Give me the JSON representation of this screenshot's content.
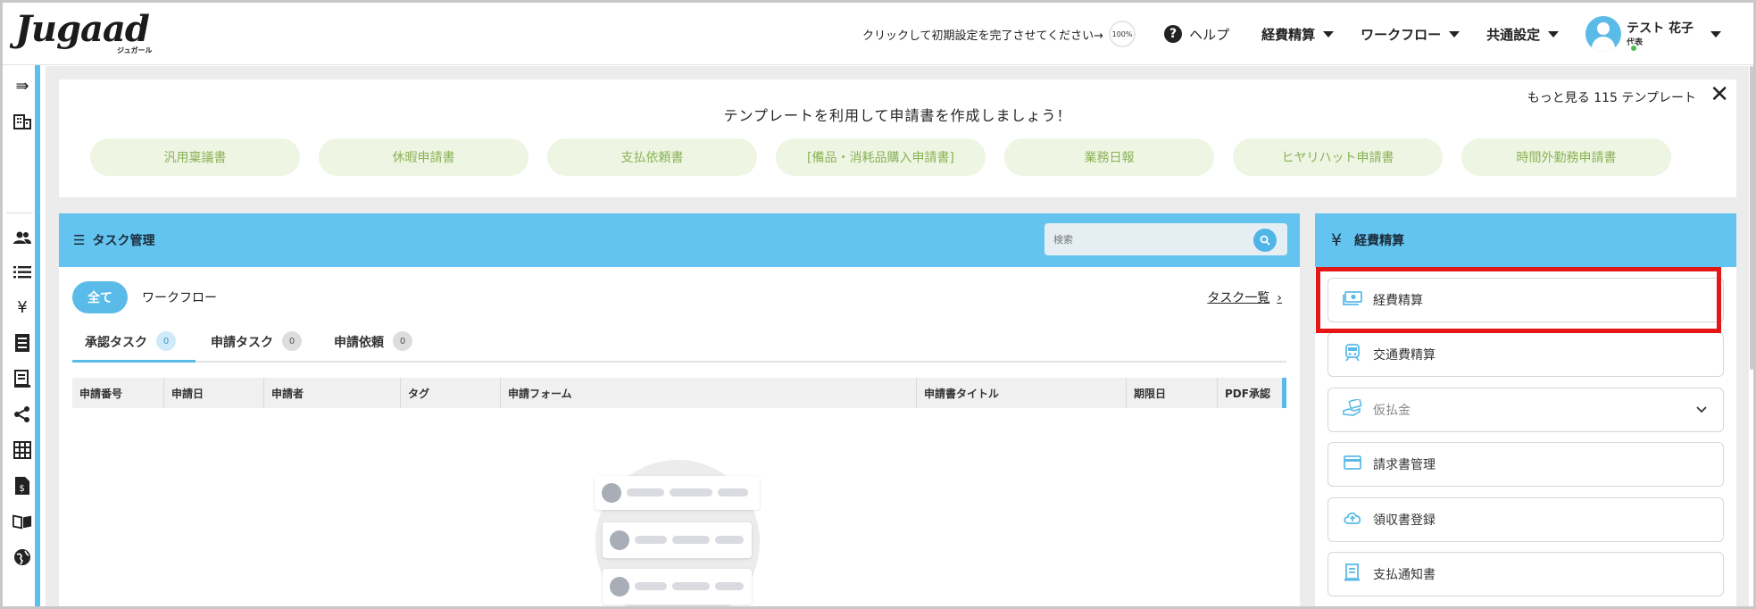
{
  "header": {
    "logo_text": "Jugaad",
    "logo_sub": "ジュガール",
    "setup_text": "クリックして初期設定を完了させてください→",
    "setup_progress": "100%",
    "help_label": "ヘルプ",
    "menus": [
      "経費精算",
      "ワークフロー",
      "共通設定"
    ],
    "user_name": "テスト 花子",
    "user_role": "代表"
  },
  "sidebar": {
    "icons": [
      "collapse-icon",
      "building-icon",
      "users-icon",
      "list-icon",
      "yen-icon",
      "document-icon",
      "receipt-icon",
      "share-icon",
      "grid-icon",
      "file-dollar-icon",
      "book-icon",
      "globe-icon"
    ]
  },
  "templates": {
    "title": "テンプレートを利用して申請書を作成しましょう！",
    "more_text": "もっと見る 115 テンプレート",
    "close_glyph": "✕",
    "items": [
      "汎用稟議書",
      "休暇申請書",
      "支払依頼書",
      "[備品・消耗品購入申請書]",
      "業務日報",
      "ヒヤリハット申請書",
      "時間外勤務申請書"
    ]
  },
  "tasks": {
    "title": "タスク管理",
    "search_placeholder": "検索",
    "filters": [
      "全て",
      "ワークフロー"
    ],
    "link_text": "タスク一覧",
    "subtabs": [
      {
        "label": "承認タスク",
        "count": "0"
      },
      {
        "label": "申請タスク",
        "count": "0"
      },
      {
        "label": "申請依頼",
        "count": "0"
      }
    ],
    "columns": [
      "申請番号",
      "申請日",
      "申請者",
      "タグ",
      "申請フォーム",
      "申請書タイトル",
      "期限日",
      "PDF承認"
    ]
  },
  "expense": {
    "title": "経費精算",
    "items": [
      {
        "label": "経費精算",
        "icon": "money-icon"
      },
      {
        "label": "交通費精算",
        "icon": "train-icon"
      },
      {
        "label": "仮払金",
        "icon": "hand-money-icon"
      },
      {
        "label": "請求書管理",
        "icon": "card-icon"
      },
      {
        "label": "領収書登録",
        "icon": "cloud-upload-icon"
      },
      {
        "label": "支払通知書",
        "icon": "notice-icon"
      }
    ]
  },
  "colors": {
    "accent": "#63c4ef",
    "template_bg": "#eef5e2",
    "template_text": "#8ab357",
    "highlight": "#e51616"
  }
}
